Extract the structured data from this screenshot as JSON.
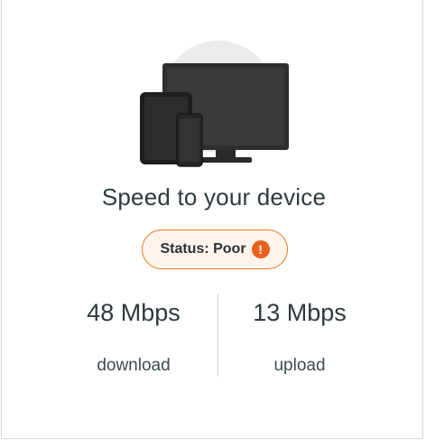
{
  "card": {
    "title": "Speed to your device",
    "illustration_icon": "devices-illustration-icon",
    "status": {
      "label": "Status: Poor",
      "icon": "warning-icon",
      "icon_glyph": "!",
      "accent_color": "#e87722"
    },
    "metrics": [
      {
        "value": "48 Mbps",
        "label": "download"
      },
      {
        "value": "13 Mbps",
        "label": "upload"
      }
    ]
  }
}
